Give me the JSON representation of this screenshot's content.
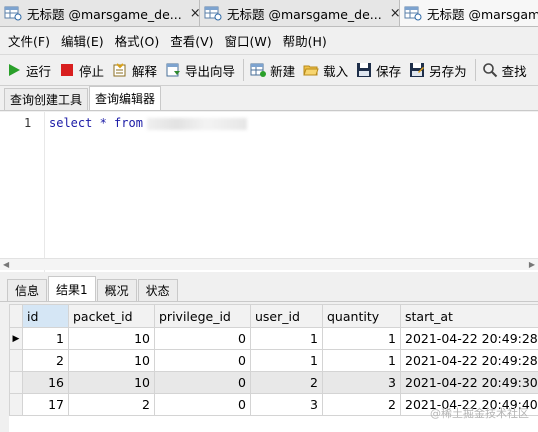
{
  "doc_tabs": [
    {
      "label": "无标题 @marsgame_de...",
      "close": "×"
    },
    {
      "label": "无标题 @marsgame_de...",
      "close": "×"
    },
    {
      "label": "无标题 @marsgame"
    }
  ],
  "menu": [
    "文件(F)",
    "编辑(E)",
    "格式(O)",
    "查看(V)",
    "窗口(W)",
    "帮助(H)"
  ],
  "toolbar": {
    "run": "运行",
    "stop": "停止",
    "explain": "解释",
    "export": "导出向导",
    "new": "新建",
    "load": "载入",
    "save": "保存",
    "save_as": "另存为",
    "find": "查找"
  },
  "sub_tabs": [
    "查询创建工具",
    "查询编辑器"
  ],
  "editor": {
    "line_number": "1",
    "code": "select * from"
  },
  "result_tabs": [
    "信息",
    "结果1",
    "概况",
    "状态"
  ],
  "grid": {
    "columns": [
      "id",
      "packet_id",
      "privilege_id",
      "user_id",
      "quantity",
      "start_at"
    ],
    "rows": [
      [
        "1",
        "10",
        "0",
        "1",
        "1",
        "2021-04-22 20:49:28"
      ],
      [
        "2",
        "10",
        "0",
        "1",
        "1",
        "2021-04-22 20:49:28"
      ],
      [
        "16",
        "10",
        "0",
        "2",
        "3",
        "2021-04-22 20:49:30"
      ],
      [
        "17",
        "2",
        "0",
        "3",
        "2",
        "2021-04-22 20:49:40"
      ]
    ],
    "row_indicator": "▶"
  },
  "watermark": "@稀土掘金技术社区"
}
